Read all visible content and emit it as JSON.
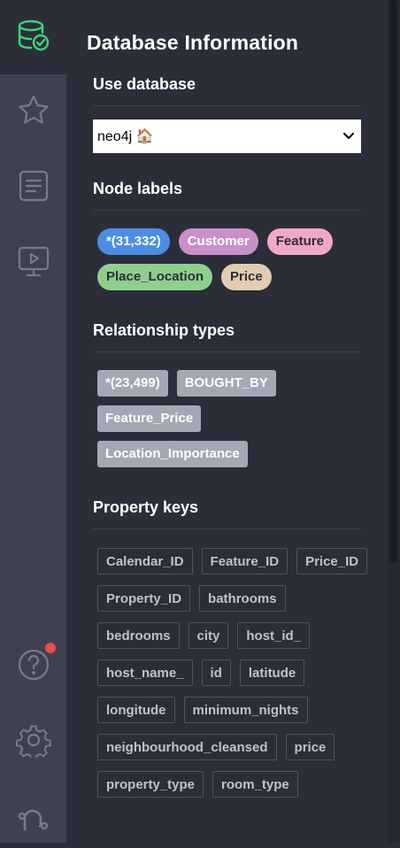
{
  "colors": {
    "accent": "#3cd37a",
    "rail_bg": "#3f4151",
    "panel_bg": "#2b2e38",
    "badge_all": "#4c8de3",
    "badge_customer": "#c98fc9",
    "badge_feature": "#f1a8c8",
    "badge_place": "#8ecf8e",
    "badge_price": "#e2cdb2",
    "rel_badge": "#a4a8b4",
    "notification": "#e94a4a"
  },
  "sidebar": {
    "icons": [
      "database-icon",
      "star-icon",
      "document-icon",
      "monitor-play-icon",
      "help-icon",
      "gear-icon",
      "neo4j-icon"
    ]
  },
  "panel": {
    "title": "Database Information",
    "use_database": {
      "heading": "Use database",
      "selected": "neo4j 🏠"
    },
    "node_labels": {
      "heading": "Node labels",
      "items": [
        {
          "label": "*(31,332)",
          "bg": "#4c8de3",
          "fg": "#ffffff"
        },
        {
          "label": "Customer",
          "bg": "#c98fc9",
          "fg": "#ffffff"
        },
        {
          "label": "Feature",
          "bg": "#f1a8c8",
          "fg": "#2b2e38"
        },
        {
          "label": "Place_Location",
          "bg": "#8ecf8e",
          "fg": "#2b2e38"
        },
        {
          "label": "Price",
          "bg": "#e2cdb2",
          "fg": "#2b2e38"
        }
      ]
    },
    "relationship_types": {
      "heading": "Relationship types",
      "items": [
        "*(23,499)",
        "BOUGHT_BY",
        "Feature_Price",
        "Location_Importance"
      ]
    },
    "property_keys": {
      "heading": "Property keys",
      "items": [
        "Calendar_ID",
        "Feature_ID",
        "Price_ID",
        "Property_ID",
        "bathrooms",
        "bedrooms",
        "city",
        "host_id_",
        "host_name_",
        "id",
        "latitude",
        "longitude",
        "minimum_nights",
        "neighbourhood_cleansed",
        "price",
        "property_type",
        "room_type"
      ]
    }
  }
}
